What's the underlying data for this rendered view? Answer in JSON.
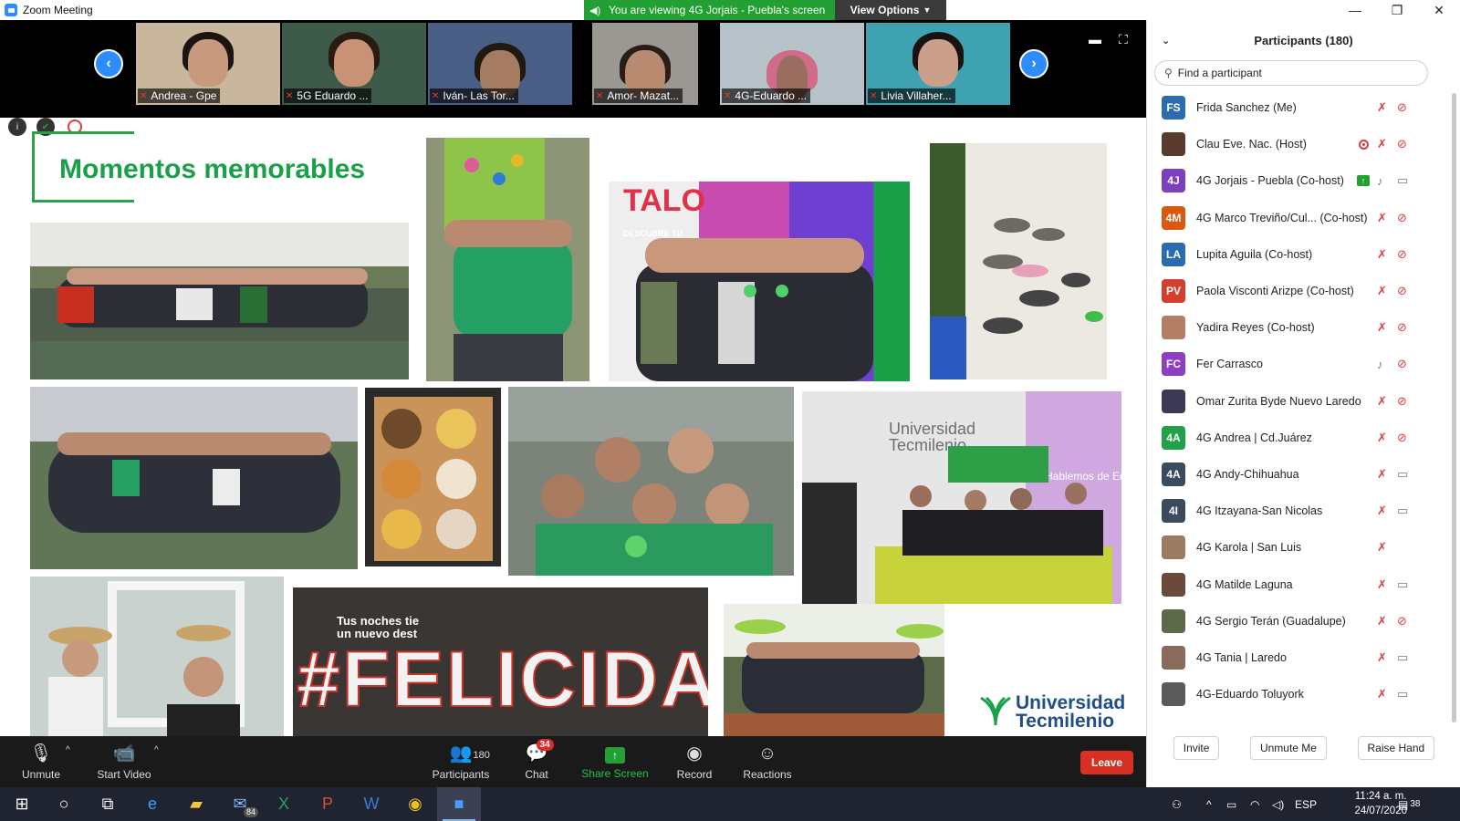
{
  "window": {
    "title": "Zoom Meeting",
    "controls": [
      "—",
      "❐",
      "✕"
    ]
  },
  "banner": {
    "message": "You are viewing 4G Jorjais - Puebla's screen",
    "view_options": "View Options"
  },
  "video_strip": [
    {
      "name": "Andrea - Gpe"
    },
    {
      "name": "5G Eduardo ..."
    },
    {
      "name": "Iván- Las Tor..."
    },
    {
      "name": "Amor- Mazat..."
    },
    {
      "name": "4G-Eduardo ..."
    },
    {
      "name": "Livia Villaher..."
    }
  ],
  "slide": {
    "title": "Momentos memorables",
    "photo_captions": {
      "talo_banner": "TALO",
      "talo_sub": "DESCUBRE TU",
      "univ_wall": "Universidad Tecmilenio",
      "univ_banner": "Hablemos de Eq",
      "felicidad_sign": "#FELICIDAD",
      "felicidad_top": "Tus noches tie un nuevo dest",
      "logo_line1": "Universidad",
      "logo_line2": "Tecmilenio"
    }
  },
  "toolbar": {
    "unmute": "Unmute",
    "start_video": "Start Video",
    "participants": "Participants",
    "participants_count": "180",
    "chat": "Chat",
    "chat_badge": "34",
    "share_screen": "Share Screen",
    "record": "Record",
    "reactions": "Reactions",
    "leave": "Leave"
  },
  "panel": {
    "title": "Participants (180)",
    "search_placeholder": "Find a participant",
    "participants": [
      {
        "initials": "FS",
        "color": "#2b6cb0",
        "name": "Frida Sanchez (Me)",
        "mic": "off",
        "cam": "off"
      },
      {
        "initials": "",
        "color": "#5a3b2e",
        "name": "Clau Eve. Nac. (Host)",
        "mic": "off",
        "cam": "off",
        "recording": true
      },
      {
        "initials": "4J",
        "color": "#7b3fbf",
        "name": "4G Jorjais - Puebla (Co-host)",
        "mic": "on",
        "cam": "on",
        "sharing": true
      },
      {
        "initials": "4M",
        "color": "#d9590f",
        "name": "4G Marco Treviño/Cul... (Co-host)",
        "mic": "off",
        "cam": "off"
      },
      {
        "initials": "LA",
        "color": "#2b6cb0",
        "name": "Lupita Aguila (Co-host)",
        "mic": "off",
        "cam": "off"
      },
      {
        "initials": "PV",
        "color": "#d23f2f",
        "name": "Paola Visconti Arizpe (Co-host)",
        "mic": "off",
        "cam": "off"
      },
      {
        "initials": "",
        "color": "#b07f66",
        "name": "Yadira Reyes (Co-host)",
        "mic": "off",
        "cam": "off"
      },
      {
        "initials": "FC",
        "color": "#8e3fbf",
        "name": "Fer Carrasco",
        "mic": "on",
        "cam": "off"
      },
      {
        "initials": "",
        "color": "#3a3a55",
        "name": "Omar Zurita Byde Nuevo Laredo",
        "mic": "off",
        "cam": "off"
      },
      {
        "initials": "4A",
        "color": "#23a04a",
        "name": "4G Andrea | Cd.Juárez",
        "mic": "off",
        "cam": "off"
      },
      {
        "initials": "4A",
        "color": "#3b4a5e",
        "name": "4G Andy-Chihuahua",
        "mic": "off",
        "cam": "on"
      },
      {
        "initials": "4I",
        "color": "#3b4a5e",
        "name": "4G Itzayana-San Nicolas",
        "mic": "off",
        "cam": "on"
      },
      {
        "initials": "",
        "color": "#9b7a62",
        "name": "4G Karola | San Luis",
        "mic": "off",
        "cam": "none"
      },
      {
        "initials": "",
        "color": "#6b4a3a",
        "name": "4G Matilde Laguna",
        "mic": "off",
        "cam": "on"
      },
      {
        "initials": "",
        "color": "#5c6a4a",
        "name": "4G Sergio Terán (Guadalupe)",
        "mic": "off",
        "cam": "off"
      },
      {
        "initials": "",
        "color": "#8a6a5a",
        "name": "4G Tania | Laredo",
        "mic": "off",
        "cam": "on"
      },
      {
        "initials": "",
        "color": "#5a5a5a",
        "name": "4G-Eduardo Toluyork",
        "mic": "off",
        "cam": "on"
      }
    ],
    "buttons": {
      "invite": "Invite",
      "unmute_me": "Unmute Me",
      "raise_hand": "Raise Hand"
    }
  },
  "taskbar": {
    "mail_badge": "84",
    "lang": "ESP",
    "time": "11:24 a. m.",
    "date": "24/07/2020",
    "notif_count": "38"
  }
}
